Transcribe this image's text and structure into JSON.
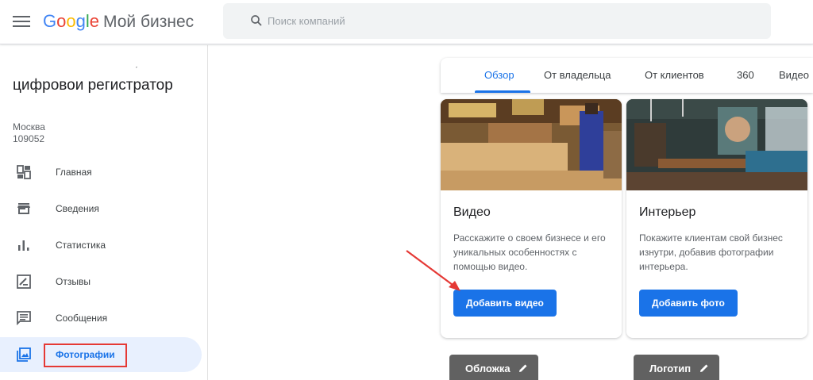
{
  "header": {
    "logo_letters": [
      "G",
      "o",
      "o",
      "g",
      "l",
      "e"
    ],
    "product": "Мой бизнес",
    "search_placeholder": "Поиск компаний"
  },
  "sidebar": {
    "business_name": "цифровои регистратор",
    "address_line1": "Москва",
    "address_line2": "109052",
    "items": [
      {
        "label": "Главная",
        "icon": "dashboard-icon"
      },
      {
        "label": "Сведения",
        "icon": "storefront-icon"
      },
      {
        "label": "Статистика",
        "icon": "bar-chart-icon"
      },
      {
        "label": "Отзывы",
        "icon": "review-icon"
      },
      {
        "label": "Сообщения",
        "icon": "message-icon"
      },
      {
        "label": "Фотографии",
        "icon": "photo-icon",
        "active": true
      }
    ]
  },
  "tabs": [
    "Обзор",
    "От владельца",
    "От клиентов",
    "360",
    "Видео"
  ],
  "active_tab": "Обзор",
  "cards": [
    {
      "title": "Видео",
      "description": "Расскажите о своем бизнесе и его уникальных особенностях с помощью видео.",
      "button": "Добавить видео"
    },
    {
      "title": "Интерьер",
      "description": "Покажите клиентам свой бизнес изнутри, добавив фотографии интерьера.",
      "button": "Добавить фото"
    }
  ],
  "chips": [
    "Обложка",
    "Логотип"
  ],
  "colors": {
    "accent": "#1a73e8",
    "highlight": "#e53935",
    "chip": "#616161"
  }
}
